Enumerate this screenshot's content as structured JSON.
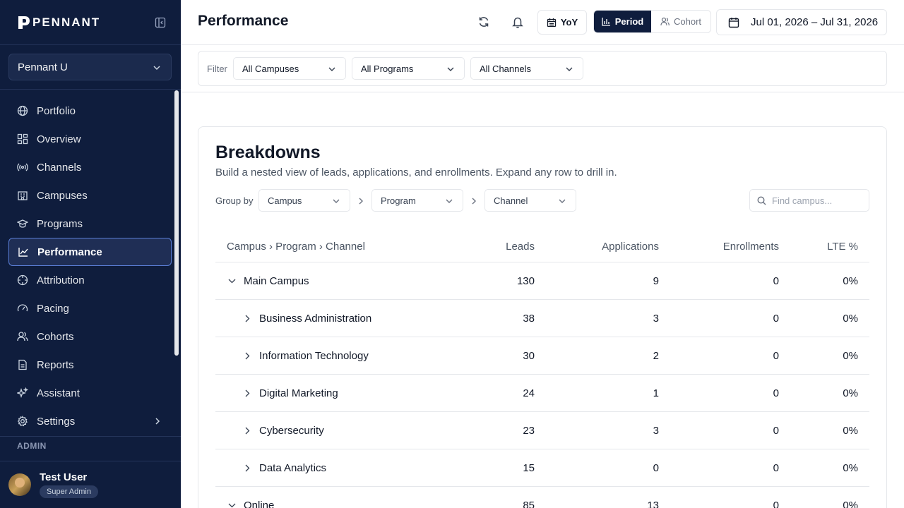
{
  "brand": {
    "name": "PENNANT"
  },
  "org": {
    "selected": "Pennant U"
  },
  "nav": {
    "items": [
      {
        "label": "Portfolio",
        "icon": "globe-icon"
      },
      {
        "label": "Overview",
        "icon": "grid-icon"
      },
      {
        "label": "Channels",
        "icon": "broadcast-icon"
      },
      {
        "label": "Campuses",
        "icon": "building-icon"
      },
      {
        "label": "Programs",
        "icon": "graduation-cap-icon"
      },
      {
        "label": "Performance",
        "icon": "line-chart-icon",
        "active": true
      },
      {
        "label": "Attribution",
        "icon": "crosshair-icon"
      },
      {
        "label": "Pacing",
        "icon": "gauge-icon"
      },
      {
        "label": "Cohorts",
        "icon": "users-icon"
      },
      {
        "label": "Reports",
        "icon": "file-icon"
      },
      {
        "label": "Assistant",
        "icon": "sparkles-icon"
      },
      {
        "label": "Settings",
        "icon": "gear-icon"
      }
    ],
    "section_label": "ADMIN"
  },
  "user": {
    "name": "Test User",
    "role": "Super Admin"
  },
  "header": {
    "title": "Performance",
    "yoy_label": "YoY",
    "segment": {
      "period": "Period",
      "cohort": "Cohort"
    },
    "date_range": "Jul 01, 2026 – Jul 31, 2026"
  },
  "filters": {
    "label": "Filter",
    "campus": "All Campuses",
    "program": "All Programs",
    "channel": "All Channels"
  },
  "breakdowns": {
    "title": "Breakdowns",
    "subtitle": "Build a nested view of leads, applications, and enrollments. Expand any row to drill in.",
    "group_by_label": "Group by",
    "group_by": [
      "Campus",
      "Program",
      "Channel"
    ],
    "search_placeholder": "Find campus...",
    "columns": {
      "name": "Campus › Program › Channel",
      "leads": "Leads",
      "applications": "Applications",
      "enrollments": "Enrollments",
      "lte": "LTE %"
    },
    "rows": [
      {
        "name": "Main Campus",
        "leads": "130",
        "applications": "9",
        "enrollments": "0",
        "lte": "0%"
      },
      {
        "name": "Business Administration",
        "leads": "38",
        "applications": "3",
        "enrollments": "0",
        "lte": "0%"
      },
      {
        "name": "Information Technology",
        "leads": "30",
        "applications": "2",
        "enrollments": "0",
        "lte": "0%"
      },
      {
        "name": "Digital Marketing",
        "leads": "24",
        "applications": "1",
        "enrollments": "0",
        "lte": "0%"
      },
      {
        "name": "Cybersecurity",
        "leads": "23",
        "applications": "3",
        "enrollments": "0",
        "lte": "0%"
      },
      {
        "name": "Data Analytics",
        "leads": "15",
        "applications": "0",
        "enrollments": "0",
        "lte": "0%"
      },
      {
        "name": "Online",
        "leads": "85",
        "applications": "13",
        "enrollments": "0",
        "lte": "0%"
      }
    ]
  }
}
